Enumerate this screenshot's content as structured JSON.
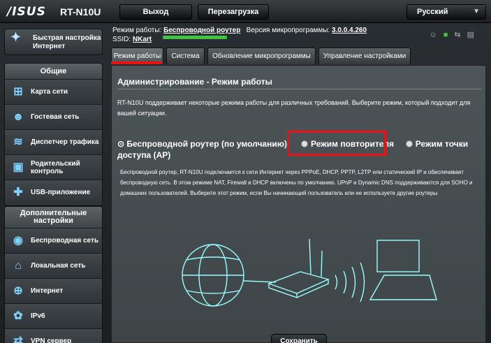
{
  "brand": {
    "logo": "/ISUS",
    "model": "RT-N10U"
  },
  "topbar": {
    "logout": "Выход",
    "reboot": "Перезагрузка",
    "language": "Русский"
  },
  "sidebar": {
    "qis": "Быстрая настройка Интернет",
    "general_title": "Общие",
    "general_items": [
      {
        "label": "Карта сети",
        "icon": "network-map-icon"
      },
      {
        "label": "Гостевая сеть",
        "icon": "guest-network-icon"
      },
      {
        "label": "Диспетчер трафика",
        "icon": "traffic-manager-icon"
      },
      {
        "label": "Родительский контроль",
        "icon": "parental-control-icon"
      },
      {
        "label": "USB-приложение",
        "icon": "usb-app-icon"
      }
    ],
    "advanced_title": "Дополнительные настройки",
    "advanced_items": [
      {
        "label": "Беспроводная сеть",
        "icon": "wireless-icon"
      },
      {
        "label": "Локальная сеть",
        "icon": "lan-icon"
      },
      {
        "label": "Интернет",
        "icon": "globe-icon"
      },
      {
        "label": "IPv6",
        "icon": "ipv6-icon"
      },
      {
        "label": "VPN сервер",
        "icon": "vpn-icon"
      }
    ]
  },
  "status": {
    "mode_label": "Режим работы:",
    "mode_value": "Беспроводной роутер",
    "fw_label": "Версия микропрограммы:",
    "fw_value": "3.0.0.4.260",
    "ssid_label": "SSID:",
    "ssid_value": "NKart"
  },
  "tabs": [
    "Режим работы",
    "Система",
    "Обновление микропрограммы",
    "Управление настройками"
  ],
  "panel": {
    "title": "Администрирование - Режим работы",
    "description": "RT-N10U поддерживает некоторые режима работы для различных требований. Выберите режим, который подходит для вашей ситуации.",
    "modes": [
      "Беспроводной роутер (по умолчанию)",
      "Режим повторителя",
      "Режим точки доступа (AP)"
    ],
    "mode_description": "Беспроводной роутер, RT-N10U подключается к сети Интернет через PPPoE, DHCP, PPTP, L2TP или статический IP и обеспечивает беспроводную сеть. В этом режиме NAT, Firewall и DHCP включены по умолчанию. UPnP и Dynamic DNS поддерживаются для SOHO и домашних пользователей. Выберите этот режим, если Вы начинающий пользователь или не используете другие роутеры",
    "save": "Сохранить"
  },
  "colors": {
    "accent_green": "#3ec43e",
    "highlight_red": "#e11111",
    "panel_bg": "#465053"
  }
}
